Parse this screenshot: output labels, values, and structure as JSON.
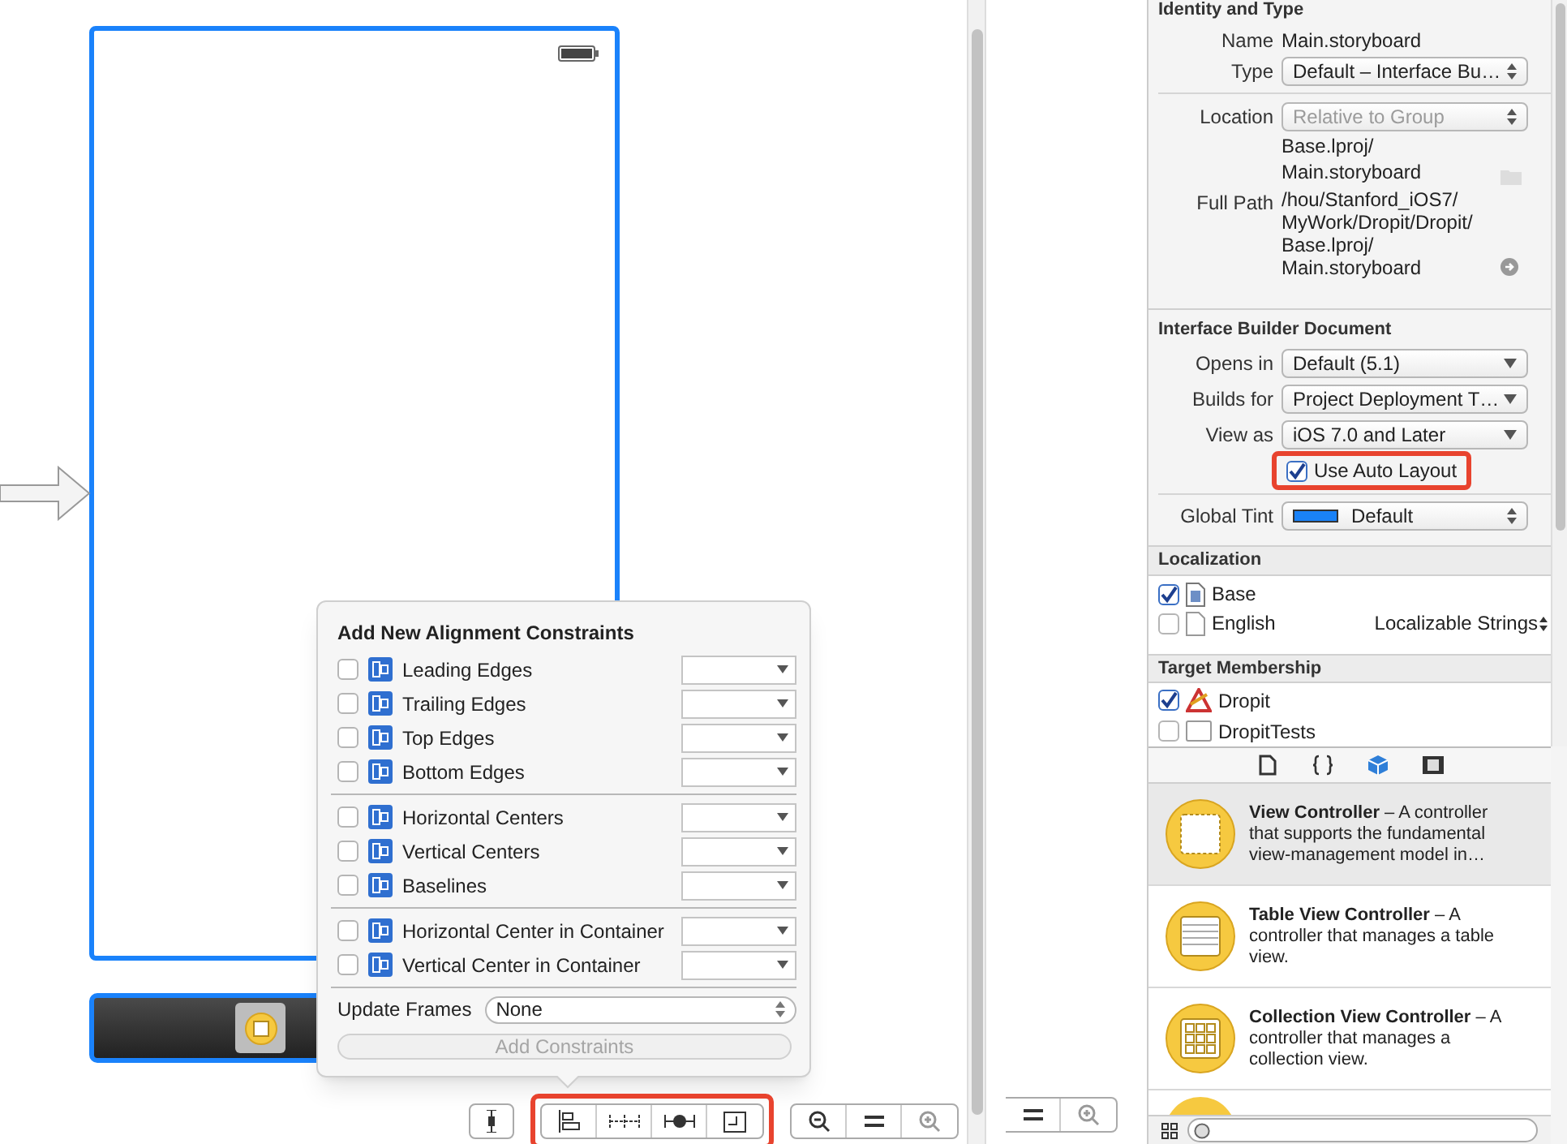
{
  "identity": {
    "title": "Identity and Type",
    "name_label": "Name",
    "name": "Main.storyboard",
    "type_label": "Type",
    "type": "Default – Interface Bu…",
    "location_label": "Location",
    "location": "Relative to Group",
    "location_lines": [
      "Base.lproj/",
      "Main.storyboard"
    ],
    "full_path_label": "Full Path",
    "full_path_lines": [
      "/hou/Stanford_iOS7/",
      "MyWork/Dropit/Dropit/",
      "Base.lproj/",
      "Main.storyboard"
    ]
  },
  "ib_document": {
    "title": "Interface Builder Document",
    "rows": [
      {
        "label": "Opens in",
        "value": "Default (5.1)"
      },
      {
        "label": "Builds for",
        "value": "Project Deployment T…"
      },
      {
        "label": "View as",
        "value": "iOS 7.0 and Later"
      }
    ],
    "auto_layout": {
      "label": "Use Auto Layout",
      "checked": true
    },
    "tint": {
      "label": "Global Tint",
      "value": "Default"
    }
  },
  "localization": {
    "title": "Localization",
    "items": [
      {
        "name": "Base",
        "checked": true,
        "kind": "storyboard"
      },
      {
        "name": "English",
        "checked": false,
        "kind": "file",
        "option": "Localizable Strings"
      }
    ]
  },
  "target_membership": {
    "title": "Target Membership",
    "items": [
      {
        "name": "Dropit",
        "checked": true,
        "kind": "app"
      },
      {
        "name": "DropitTests",
        "checked": false,
        "kind": "bundle"
      }
    ]
  },
  "library": {
    "tabs": [
      {
        "kind": "file",
        "selected": false
      },
      {
        "kind": "code",
        "selected": false
      },
      {
        "kind": "object",
        "selected": true
      },
      {
        "kind": "media",
        "selected": false
      }
    ],
    "items": [
      {
        "kind": "view",
        "selected": true,
        "text": "**View Controller** – A controller that supports the fundamental view-management model in…"
      },
      {
        "kind": "table",
        "selected": false,
        "text": "**Table View Controller** – A controller that manages a table view."
      },
      {
        "kind": "collection",
        "selected": false,
        "text": "**Collection View Controller** – A controller that manages a collection view."
      }
    ]
  },
  "popover": {
    "title": "Add New Alignment Constraints",
    "groups": [
      [
        {
          "label": "Leading Edges",
          "checked": false
        },
        {
          "label": "Trailing Edges",
          "checked": false
        },
        {
          "label": "Top Edges",
          "checked": false
        },
        {
          "label": "Bottom Edges",
          "checked": false
        }
      ],
      [
        {
          "label": "Horizontal Centers",
          "checked": false
        },
        {
          "label": "Vertical Centers",
          "checked": false
        },
        {
          "label": "Baselines",
          "checked": false
        }
      ],
      [
        {
          "label": "Horizontal Center in Container",
          "checked": false
        },
        {
          "label": "Vertical Center in Container",
          "checked": false
        }
      ]
    ],
    "update_frames_label": "Update Frames",
    "update_frames": "None",
    "button": {
      "label": "Add Constraints",
      "disabled": true
    }
  }
}
